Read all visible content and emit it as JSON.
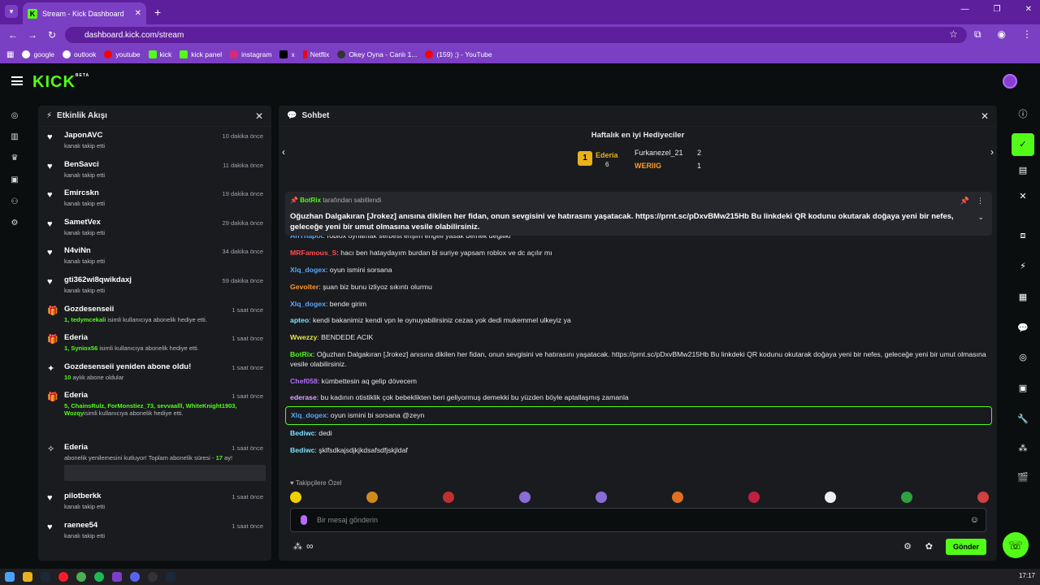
{
  "browser": {
    "tab_title": "Stream - Kick Dashboard",
    "url": "dashboard.kick.com/stream",
    "bookmarks": [
      "google",
      "outlook",
      "youtube",
      "kick",
      "kick panel",
      "instagram",
      "x",
      "Netflix",
      "Okey Oyna - Canlı 1...",
      "(159) ;) - YouTube"
    ]
  },
  "app": {
    "logo": "KICK",
    "logo_tag": "BETA"
  },
  "activity": {
    "title": "Etkinlik Akışı",
    "events": [
      {
        "icon": "heart-icon",
        "name": "JaponAVC",
        "sub": "kanalı takip etti",
        "time": "10 dakika önce"
      },
      {
        "icon": "heart-icon",
        "name": "BenSavci",
        "sub": "kanalı takip etti",
        "time": "11 dakika önce"
      },
      {
        "icon": "heart-icon",
        "name": "Emircskn",
        "sub": "kanalı takip etti",
        "time": "19 dakika önce"
      },
      {
        "icon": "heart-icon",
        "name": "SametVex",
        "sub": "kanalı takip etti",
        "time": "29 dakika önce"
      },
      {
        "icon": "heart-icon",
        "name": "N4viNn",
        "sub": "kanalı takip etti",
        "time": "34 dakika önce"
      },
      {
        "icon": "heart-icon",
        "name": "gti362wi8qwikdaxj",
        "sub": "kanalı takip etti",
        "time": "59 dakika önce"
      },
      {
        "icon": "gift-icon",
        "name": "Gozdesenseii",
        "sub_green": "1, tedymcekali",
        "sub": " isimli kullanıcıya abonelik hediye etti.",
        "time": "1 saat önce"
      },
      {
        "icon": "gift-icon",
        "name": "Ederia",
        "sub_green": "1, Syniox56",
        "sub": " isimli kullanıcıya abonelik hediye etti.",
        "time": "1 saat önce"
      },
      {
        "icon": "star-icon",
        "name": "Gozdesenseii yeniden abone oldu!",
        "sub_green": "10",
        "sub": " aylık abone oldular",
        "time": "1 saat önce"
      },
      {
        "icon": "gift-icon",
        "name": "Ederia",
        "sub_green": "5, ChainsRulz, ForMonstiez_73, sevvaalll, WhiteKnight1903, Wozqy",
        "sub": "isimli kullanıcıya abonelik hediye etti.",
        "time": "1 saat önce"
      },
      {
        "icon": "sparkle-icon",
        "name": "Ederia",
        "sub": "abonelik yenilemesini kutluyor! Toplam abonelik süresi - ",
        "sub_green": "17",
        "sub_tail": " ay!",
        "time": "1 saat önce"
      },
      {
        "icon": "heart-icon",
        "name": "pilotberkk",
        "sub": "kanalı takip etti",
        "time": "1 saat önce"
      },
      {
        "icon": "heart-icon",
        "name": "raenee54",
        "sub": "kanalı takip etti",
        "time": "1 saat önce"
      }
    ]
  },
  "chat": {
    "title": "Sohbet",
    "gifters_title": "Haftalık en iyi Hediyeciler",
    "gifters": [
      {
        "name": "Ederia",
        "count": "6",
        "rank": "1"
      },
      {
        "name": "Furkanezel_21",
        "count": "2"
      },
      {
        "name": "WERIIG",
        "count": "1"
      }
    ],
    "pinned_by": "BotRix",
    "pinned_suffix": "tarafından sabitlendi",
    "pinned_msg": "Oğuzhan Dalgakıran [Jrokez] anısına dikilen her fidan, onun sevgisini ve hatırasını yaşatacak. https://prnt.sc/pDxvBMw215Hb Bu linkdeki QR kodunu okutarak doğaya yeni bir nefes, geleceğe yeni bir umut olmasına vesile olabilirsiniz.",
    "messages": [
      {
        "user": "AhThapot",
        "color": "#58a6ff",
        "text": ": roblox oynamak serbest erişim engeli yasak demek değiliki"
      },
      {
        "user": "MRFamous_S",
        "color": "#ff4d4d",
        "text": ": hacı ben hataydayım burdan bi suriye yapsam roblox ve dc açılır mı"
      },
      {
        "user": "Xlq_dogex",
        "color": "#58a6ff",
        "text": ": oyun ismini sorsana"
      },
      {
        "user": "Gevolter",
        "color": "#ff9a2e",
        "text": ": şuan biz bunu izliyoz sıkıntı olurmu"
      },
      {
        "user": "Xlq_dogex",
        "color": "#58a6ff",
        "text": ": bende girim"
      },
      {
        "user": "apteo",
        "color": "#7ce0ff",
        "text": ": kendi bakanimiz kendi vpn le oynuyabilirsiniz cezas yok dedi mukemmel ulkeyiz ya"
      },
      {
        "user": "Wwezzy",
        "color": "#e8e04f",
        "text": ": BENDEDE ACIK"
      },
      {
        "user": "BotRix",
        "color": "#53fc18",
        "text": ": Oğuzhan Dalgakıran [Jrokez] anısına dikilen her fidan, onun sevgisini ve hatırasını yaşatacak. https://prnt.sc/pDxvBMw215Hb Bu linkdeki QR kodunu okutarak doğaya yeni bir nefes, geleceğe yeni bir umut olmasına vesile olabilirsiniz."
      },
      {
        "user": "Chef058",
        "color": "#b46cff",
        "text": ": kümbettesin aq gelip dövecem"
      },
      {
        "user": "ederase",
        "color": "#e0a0ff",
        "text": ": bu kadının otistiklik çok bebeklikten beri geliyormuş demekki bu yüzden böyle aptallaşmış zamanla"
      },
      {
        "user": "Xlq_dogex",
        "color": "#58a6ff",
        "text": ": oyun ismini bi sorsana @zeyn"
      },
      {
        "user": "Bediwc",
        "color": "#7ce0ff",
        "text": ": dedi"
      },
      {
        "user": "Bediwc",
        "color": "#7ce0ff",
        "text": ": şklfsdkajsdjkjkdsafsdfjskjldaf"
      }
    ],
    "followers_label": "Takipçilere Özel",
    "input_placeholder": "Bir mesaj gönderin",
    "send_label": "Gönder",
    "infinity_label": "∞"
  },
  "taskbar": {
    "time": "17:17"
  }
}
